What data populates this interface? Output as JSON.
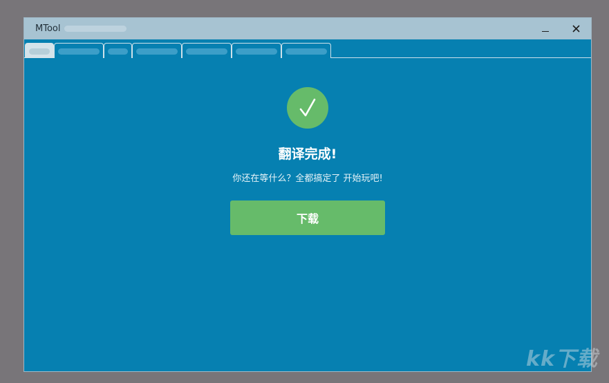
{
  "window": {
    "title": "MTool"
  },
  "tabs": [
    {
      "label": ""
    },
    {
      "label": ""
    },
    {
      "label": ""
    },
    {
      "label": ""
    },
    {
      "label": ""
    },
    {
      "label": ""
    },
    {
      "label": ""
    }
  ],
  "content": {
    "heading": "翻译完成!",
    "subtext": "你还在等什么？全都搞定了 开始玩吧!",
    "download_label": "下载"
  },
  "watermark": "kk下载",
  "icons": {
    "check": "check-icon",
    "minimize": "minimize-icon",
    "close": "close-icon"
  },
  "colors": {
    "content_bg": "#0680b1",
    "titlebar_bg": "#a7c3d2",
    "success_green": "#66bb6a",
    "desktop_bg": "#787579"
  }
}
